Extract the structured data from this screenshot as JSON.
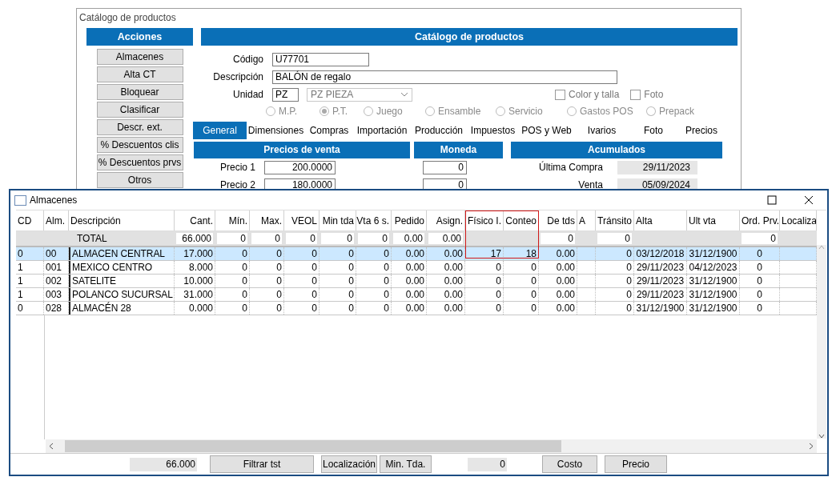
{
  "catalog_window": {
    "title": "Catálogo de productos",
    "actions": {
      "title": "Acciones",
      "buttons": [
        "Almacenes",
        "Alta CT",
        "Bloquear",
        "Clasificar",
        "Descr. ext.",
        "%  Descuentos clis",
        "%  Descuentos prvs",
        "Otros"
      ]
    },
    "header": "Catálogo de productos",
    "fields": [
      {
        "label": "Código",
        "value": "U77701"
      },
      {
        "label": "Descripción",
        "value": "BALÓN de regalo"
      }
    ],
    "unit": {
      "label": "Unidad",
      "code": "PZ",
      "select": "PZ  PIEZA"
    },
    "checkboxes": [
      {
        "label": "Color y talla",
        "checked": false
      },
      {
        "label": "Foto",
        "checked": false
      }
    ],
    "types": [
      {
        "label": "M.P.",
        "selected": false,
        "disabled": true
      },
      {
        "label": "P.T.",
        "selected": true,
        "disabled": true
      },
      {
        "label": "Juego",
        "selected": false,
        "disabled": true
      },
      {
        "label": "Ensamble",
        "selected": false,
        "disabled": true
      },
      {
        "label": "Servicio",
        "selected": false,
        "disabled": true
      },
      {
        "label": "Gastos POS",
        "selected": false,
        "disabled": true
      },
      {
        "label": "Prepack",
        "selected": false,
        "disabled": true
      }
    ],
    "tabs": [
      {
        "label": "General",
        "selected": true
      },
      {
        "label": "Dimensiones",
        "selected": false
      },
      {
        "label": "Compras",
        "selected": false
      },
      {
        "label": "Importación",
        "selected": false
      },
      {
        "label": "Producción",
        "selected": false
      },
      {
        "label": "Impuestos",
        "selected": false
      },
      {
        "label": "POS y Web",
        "selected": false
      },
      {
        "label": "Ivarios",
        "selected": false
      },
      {
        "label": "Foto",
        "selected": false
      },
      {
        "label": "Precios",
        "selected": false
      }
    ],
    "sections": [
      "Precios de venta",
      "Moneda",
      "Acumulados"
    ],
    "prices": [
      {
        "label": "Precio 1",
        "value": "200.0000",
        "currency": "0"
      },
      {
        "label": "Precio 2",
        "value": "180.0000",
        "currency": "0"
      }
    ],
    "accumulated": [
      {
        "label": "Última  Compra",
        "value": "29/11/2023"
      },
      {
        "label": "Venta",
        "value": "05/09/2024"
      }
    ]
  },
  "almacenes_window": {
    "title": "Almacenes",
    "columns": [
      {
        "label": "CD",
        "kind": "text",
        "highlighted": false
      },
      {
        "label": "Alm.",
        "kind": "text",
        "highlighted": false
      },
      {
        "label": "Descripción",
        "kind": "text",
        "highlighted": false
      },
      {
        "label": "Cant.",
        "kind": "number",
        "highlighted": false
      },
      {
        "label": "Mín.",
        "kind": "number",
        "highlighted": false
      },
      {
        "label": "Max.",
        "kind": "number",
        "highlighted": false
      },
      {
        "label": "VEOL",
        "kind": "number",
        "highlighted": false
      },
      {
        "label": "Min tda",
        "kind": "number",
        "highlighted": false
      },
      {
        "label": "Vta 6 s.",
        "kind": "number",
        "highlighted": false
      },
      {
        "label": "Pedido",
        "kind": "number",
        "highlighted": false
      },
      {
        "label": "Asign.",
        "kind": "number",
        "highlighted": false
      },
      {
        "label": "Físico I.",
        "kind": "number",
        "highlighted": true
      },
      {
        "label": "Conteo",
        "kind": "number",
        "highlighted": true
      },
      {
        "label": "De tds",
        "kind": "number",
        "highlighted": false
      },
      {
        "label": "A",
        "kind": "blank",
        "highlighted": false
      },
      {
        "label": "Tránsito",
        "kind": "number",
        "highlighted": false
      },
      {
        "label": "Alta",
        "kind": "date",
        "highlighted": false
      },
      {
        "label": "Ult vta",
        "kind": "date",
        "highlighted": false
      },
      {
        "label": "Ord. Prv.",
        "kind": "center",
        "highlighted": false
      },
      {
        "label": "Localiza",
        "kind": "blank",
        "highlighted": false
      }
    ],
    "total_row": [
      {
        "kind": "blank"
      },
      {
        "kind": "blank"
      },
      {
        "kind": "label",
        "value": "TOTAL"
      },
      {
        "kind": "field",
        "value": "66.000"
      },
      {
        "kind": "field",
        "value": "0"
      },
      {
        "kind": "field",
        "value": "0"
      },
      {
        "kind": "field",
        "value": "0"
      },
      {
        "kind": "field",
        "value": "0"
      },
      {
        "kind": "field",
        "value": "0"
      },
      {
        "kind": "field",
        "value": "0.00"
      },
      {
        "kind": "field",
        "value": "0.00"
      },
      {
        "kind": "blank"
      },
      {
        "kind": "blank"
      },
      {
        "kind": "field",
        "value": "0"
      },
      {
        "kind": "blank"
      },
      {
        "kind": "field",
        "value": "0"
      },
      {
        "kind": "blank"
      },
      {
        "kind": "blank"
      },
      {
        "kind": "field",
        "value": "0"
      },
      {
        "kind": "blank"
      }
    ],
    "rows": [
      {
        "selected": true,
        "cells": [
          "0",
          "00",
          "ALMACEN CENTRAL",
          "17.000",
          "0",
          "0",
          "0",
          "0",
          "0",
          "0.00",
          "0.00",
          "17",
          "18",
          "0.00",
          "",
          "0",
          "03/12/2018",
          "31/12/1900",
          "0",
          ""
        ]
      },
      {
        "selected": false,
        "cells": [
          "1",
          "001",
          "MEXICO CENTRO",
          "8.000",
          "0",
          "0",
          "0",
          "0",
          "0",
          "0.00",
          "0.00",
          "0",
          "0",
          "0.00",
          "",
          "0",
          "29/11/2023",
          "04/12/2023",
          "0",
          ""
        ]
      },
      {
        "selected": false,
        "cells": [
          "1",
          "002",
          "SATELITE",
          "10.000",
          "0",
          "0",
          "0",
          "0",
          "0",
          "0.00",
          "0.00",
          "0",
          "0",
          "0.00",
          "",
          "0",
          "29/11/2023",
          "31/12/1900",
          "0",
          ""
        ]
      },
      {
        "selected": false,
        "cells": [
          "1",
          "003",
          "POLANCO SUCURSAL",
          "31.000",
          "0",
          "0",
          "0",
          "0",
          "0",
          "0.00",
          "0.00",
          "0",
          "0",
          "0.00",
          "",
          "0",
          "29/11/2023",
          "31/12/1900",
          "0",
          ""
        ]
      },
      {
        "selected": false,
        "cells": [
          "0",
          "028",
          "ALMACÉN 28",
          "0.000",
          "0",
          "0",
          "0",
          "0",
          "0",
          "0.00",
          "0.00",
          "0",
          "0",
          "0.00",
          "",
          "0",
          "31/12/1900",
          "31/12/1900",
          "0",
          ""
        ]
      }
    ],
    "footer": [
      {
        "kind": "readout",
        "value": "66.000"
      },
      {
        "kind": "button",
        "value": "Filtrar  tst"
      },
      {
        "kind": "button",
        "value": "Localización"
      },
      {
        "kind": "button",
        "value": "Min. Tda."
      },
      {
        "kind": "readout",
        "value": "0"
      },
      {
        "kind": "button",
        "value": "Costo"
      },
      {
        "kind": "button",
        "value": "Precio"
      }
    ]
  }
}
